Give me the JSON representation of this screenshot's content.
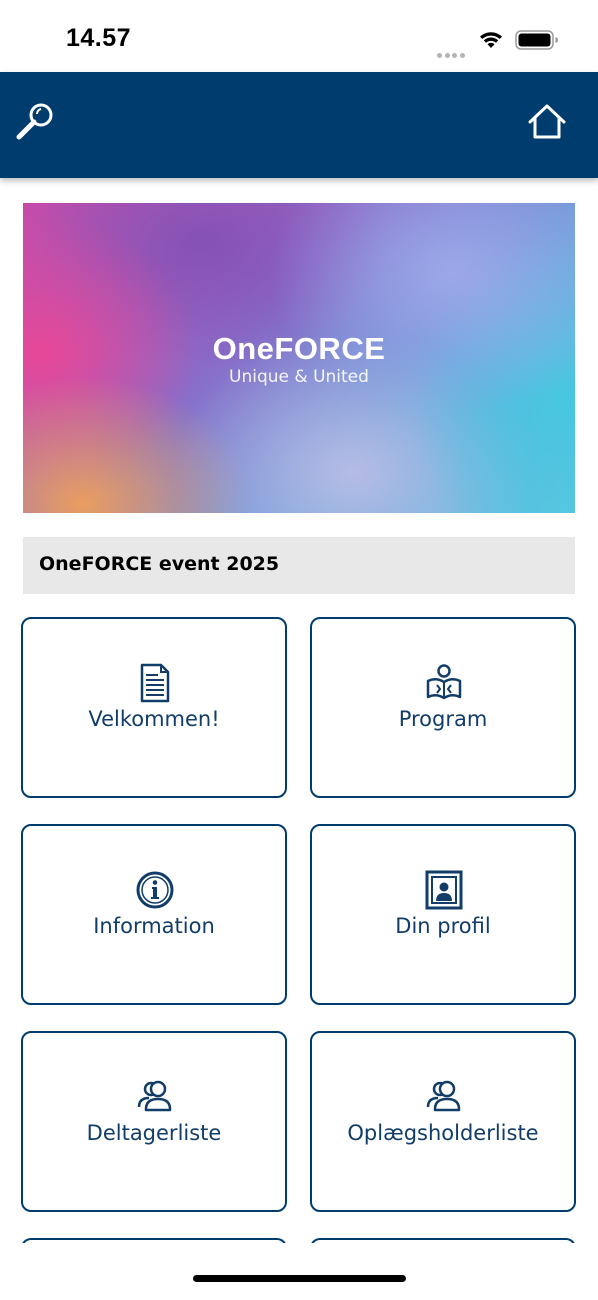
{
  "status_bar": {
    "time": "14.57",
    "signal_icon": "signal-dots-icon",
    "wifi_icon": "wifi-icon",
    "battery_icon": "battery-icon"
  },
  "header": {
    "background_color": "#003c6e",
    "search_icon": "search-icon",
    "home_icon": "home-icon"
  },
  "banner": {
    "title": "OneFORCE",
    "subtitle": "Unique & United"
  },
  "event": {
    "title": "OneFORCE event 2025"
  },
  "tiles": [
    {
      "label": "Velkommen!",
      "icon": "document-icon"
    },
    {
      "label": "Program",
      "icon": "reading-person-icon"
    },
    {
      "label": "Information",
      "icon": "info-icon"
    },
    {
      "label": "Din profil",
      "icon": "profile-picture-icon"
    },
    {
      "label": "Deltagerliste",
      "icon": "users-icon"
    },
    {
      "label": "Oplægsholderliste",
      "icon": "users-icon"
    }
  ],
  "colors": {
    "accent": "#003c6e",
    "tile_text": "#123d68",
    "event_bar": "#e8e8e8"
  }
}
